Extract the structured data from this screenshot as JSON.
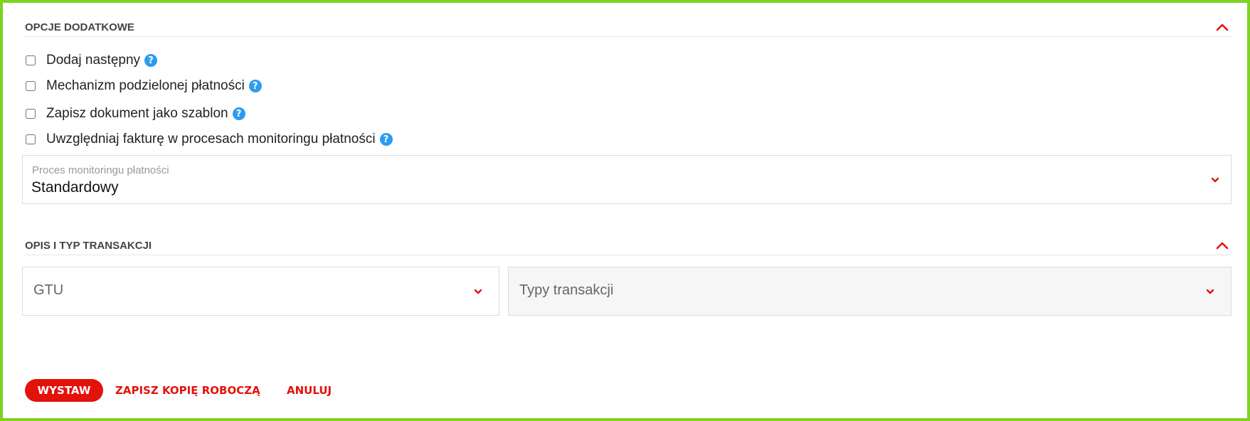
{
  "options_section": {
    "title": "OPCJE DODATKOWE",
    "checkboxes": [
      {
        "label": "Dodaj następny",
        "checked": false,
        "help_icon": "question-circle-icon"
      },
      {
        "label": "Mechanizm podzielonej płatności",
        "checked": false,
        "help_icon": "question-circle-icon"
      },
      {
        "label": "Zapisz dokument jako szablon",
        "checked": false,
        "help_icon": "question-circle-icon"
      },
      {
        "label": "Uwzględniaj fakturę w procesach monitoringu płatności",
        "checked": false,
        "help_icon": "question-circle-icon"
      }
    ],
    "monitoring_select": {
      "label": "Proces monitoringu płatności",
      "value": "Standardowy"
    }
  },
  "transaction_section": {
    "title": "OPIS I TYP TRANSAKCJI",
    "gtu_select": {
      "placeholder": "GTU"
    },
    "types_select": {
      "placeholder": "Typy transakcji"
    }
  },
  "actions": {
    "issue_label": "WYSTAW",
    "save_draft_label": "ZAPISZ KOPIĘ ROBOCZĄ",
    "cancel_label": "ANULUJ"
  },
  "colors": {
    "accent": "#e3120b",
    "frame": "#7ed321",
    "help": "#2d9bf0"
  }
}
